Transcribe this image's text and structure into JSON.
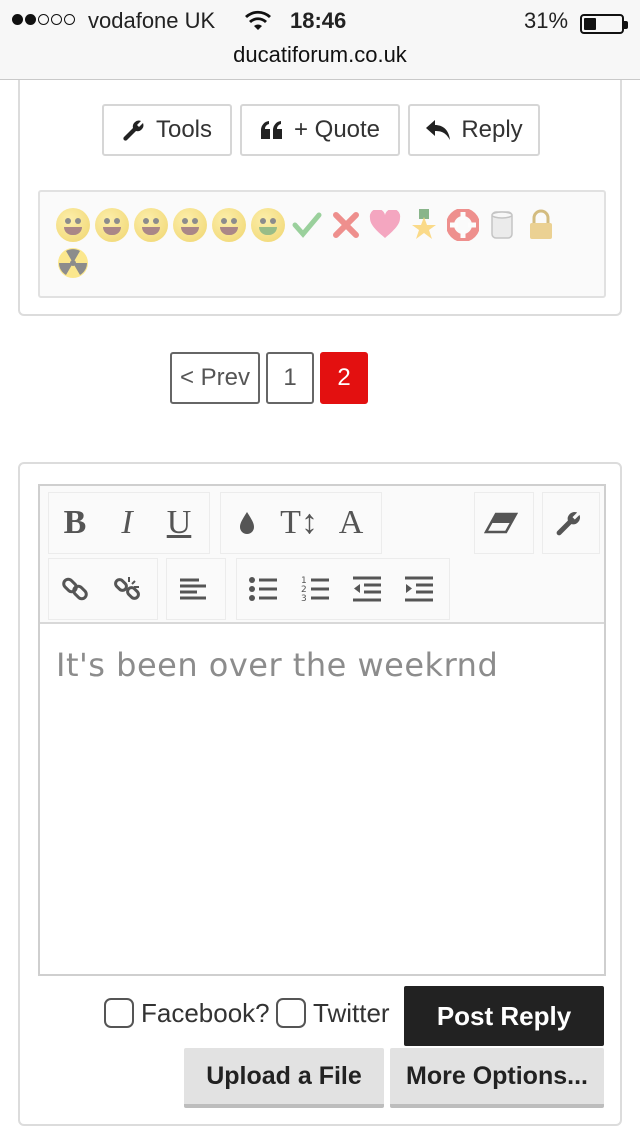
{
  "status_bar": {
    "carrier": "vodafone UK",
    "time": "18:46",
    "battery_percent": "31%",
    "signal_bars_filled": 2,
    "signal_bars_total": 5
  },
  "browser": {
    "url": "ducatiforum.co.uk"
  },
  "post_actions": {
    "tools_label": "Tools",
    "quote_label": "+ Quote",
    "reply_label": "Reply"
  },
  "reactions": {
    "icons": [
      "like-smiley",
      "wink-smiley",
      "tongue-smiley",
      "facepalm-smiley",
      "laugh-smiley",
      "sick-smiley",
      "check-mark",
      "cross-mark",
      "heart",
      "star-medal",
      "lifebuoy",
      "toilet-roll",
      "padlock",
      "radioactive"
    ]
  },
  "pagination": {
    "prev_label": "< Prev",
    "pages": [
      "1",
      "2"
    ],
    "current_page": "2"
  },
  "editor": {
    "toolbar_row1": [
      "bold",
      "italic",
      "underline",
      "text-color",
      "font-size",
      "font-family",
      "remove-format",
      "tools"
    ],
    "toolbar_row2": [
      "link",
      "unlink",
      "align",
      "bullet-list",
      "numbered-list",
      "outdent",
      "indent"
    ],
    "bold_label": "B",
    "italic_label": "I",
    "underline_label": "U",
    "font_size_label": "T↕",
    "font_family_label": "A",
    "content": "It's been over the weekrnd"
  },
  "share": {
    "facebook_label": "Facebook?",
    "twitter_label": "Twitter"
  },
  "buttons": {
    "post_reply": "Post Reply",
    "upload_file": "Upload a File",
    "more_options": "More Options..."
  },
  "colors": {
    "active_page": "#e31010",
    "post_reply_bg": "#222222"
  }
}
